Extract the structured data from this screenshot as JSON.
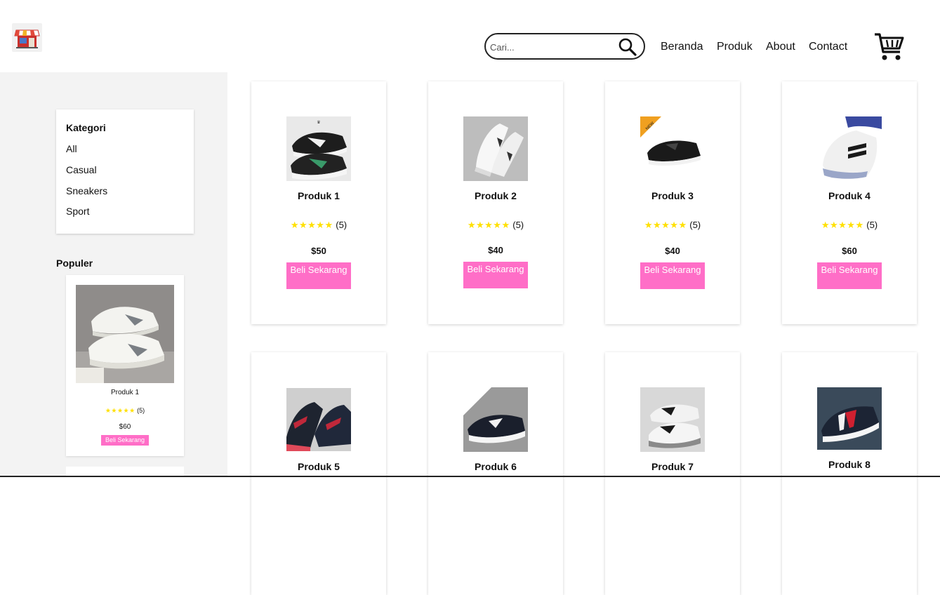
{
  "header": {
    "search_placeholder": "Cari...",
    "nav": [
      "Beranda",
      "Produk",
      "About",
      "Contact"
    ]
  },
  "sidebar": {
    "kategori_title": "Kategori",
    "kategori_items": [
      "All",
      "Casual",
      "Sneakers",
      "Sport"
    ],
    "populer_title": "Populer",
    "populer_card": {
      "name": "Produk 1",
      "stars": "★★★★★",
      "rating_count": "(5)",
      "price": "$60",
      "button": "Beli Sekarang"
    }
  },
  "products": [
    {
      "name": "Produk 1",
      "stars": "★★★★★",
      "rating_count": "(5)",
      "price": "$50",
      "button": "Beli Sekarang"
    },
    {
      "name": "Produk 2",
      "stars": "★★★★★",
      "rating_count": "(5)",
      "price": "$40",
      "button": "Beli Sekarang"
    },
    {
      "name": "Produk 3",
      "stars": "★★★★★",
      "rating_count": "(5)",
      "price": "$40",
      "button": "Beli Sekarang"
    },
    {
      "name": "Produk 4",
      "stars": "★★★★★",
      "rating_count": "(5)",
      "price": "$60",
      "button": "Beli Sekarang"
    },
    {
      "name": "Produk 5"
    },
    {
      "name": "Produk 6"
    },
    {
      "name": "Produk 7"
    },
    {
      "name": "Produk 8"
    }
  ],
  "colors": {
    "accent_button": "#ff6ec7",
    "star": "#ffe000",
    "sidebar_bg": "#f3f3f3"
  },
  "icons": {
    "logo": "store-icon",
    "search": "search-icon",
    "cart": "cart-icon"
  }
}
